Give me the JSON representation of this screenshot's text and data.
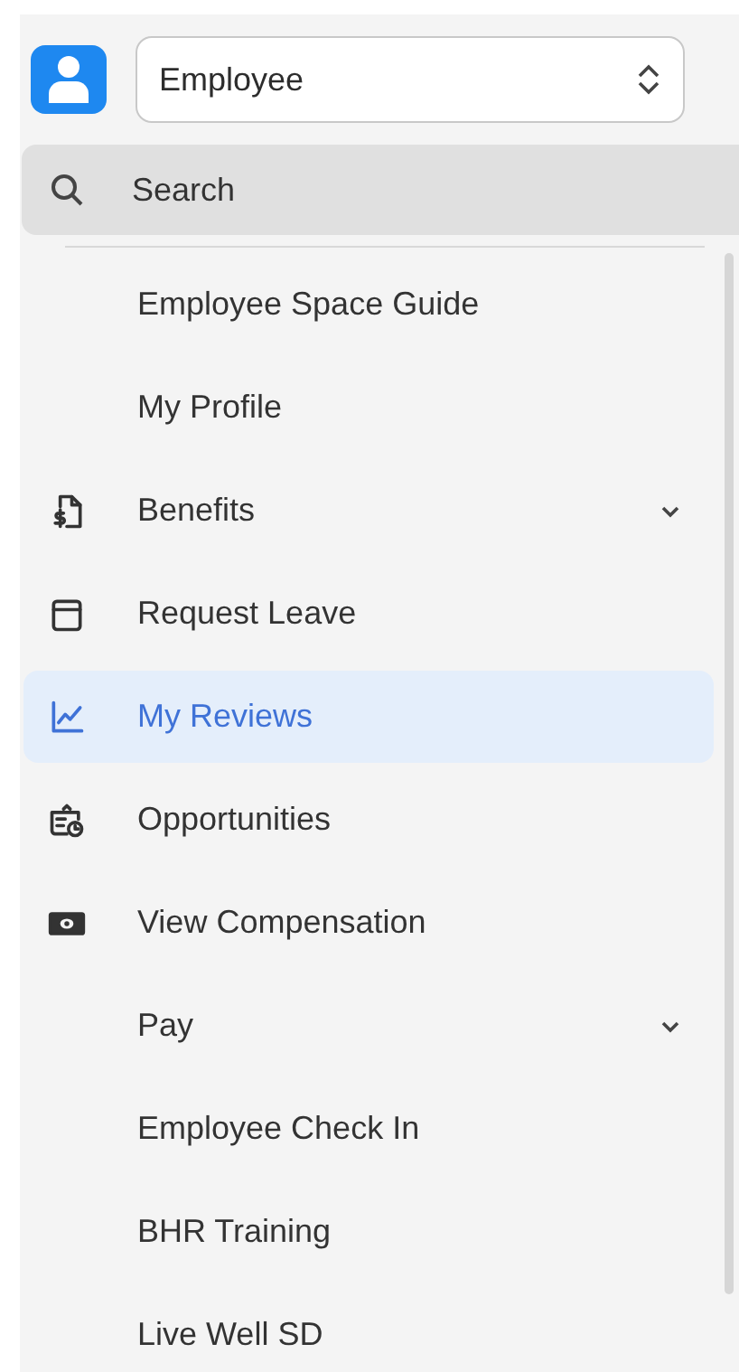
{
  "space_select": {
    "value": "Employee"
  },
  "search": {
    "label": "Search"
  },
  "nav": {
    "items": [
      {
        "label": "Employee Space Guide",
        "kind": "plain",
        "selected": false,
        "has_children": false
      },
      {
        "label": "My Profile",
        "kind": "plain",
        "selected": false,
        "has_children": false
      },
      {
        "label": "Benefits",
        "kind": "dollar",
        "selected": false,
        "has_children": true
      },
      {
        "label": "Request Leave",
        "kind": "calendar",
        "selected": false,
        "has_children": false
      },
      {
        "label": "My Reviews",
        "kind": "chart",
        "selected": true,
        "has_children": false
      },
      {
        "label": "Opportunities",
        "kind": "clock",
        "selected": false,
        "has_children": false
      },
      {
        "label": "View Compensation",
        "kind": "cash",
        "selected": false,
        "has_children": false
      },
      {
        "label": "Pay",
        "kind": "plain",
        "selected": false,
        "has_children": true
      },
      {
        "label": "Employee Check In",
        "kind": "plain",
        "selected": false,
        "has_children": false
      },
      {
        "label": "BHR Training",
        "kind": "plain",
        "selected": false,
        "has_children": false
      },
      {
        "label": "Live Well SD",
        "kind": "plain",
        "selected": false,
        "has_children": false
      }
    ]
  }
}
